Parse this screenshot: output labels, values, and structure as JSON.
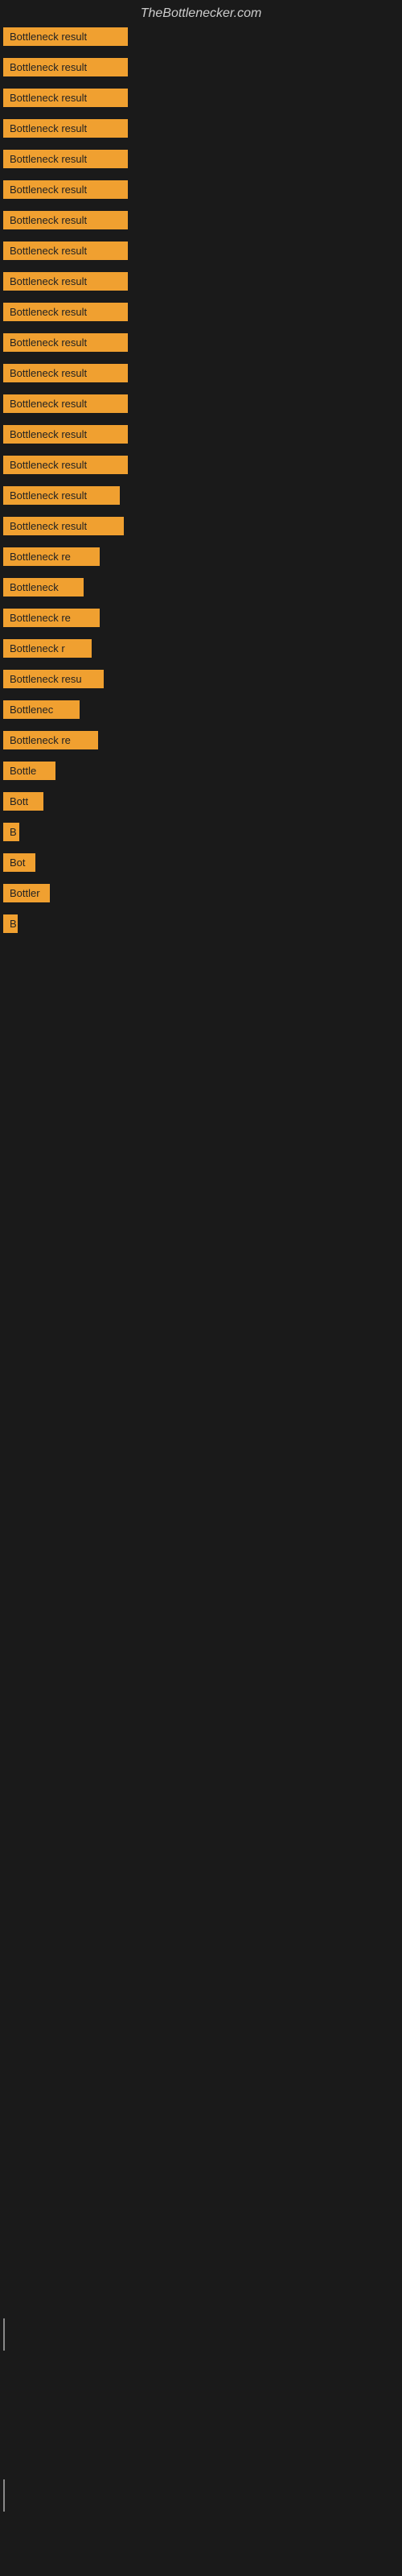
{
  "site": {
    "title": "TheBottlenecker.com"
  },
  "results": [
    {
      "label": "Bottleneck result",
      "width": 155
    },
    {
      "label": "Bottleneck result",
      "width": 155
    },
    {
      "label": "Bottleneck result",
      "width": 155
    },
    {
      "label": "Bottleneck result",
      "width": 155
    },
    {
      "label": "Bottleneck result",
      "width": 155
    },
    {
      "label": "Bottleneck result",
      "width": 155
    },
    {
      "label": "Bottleneck result",
      "width": 155
    },
    {
      "label": "Bottleneck result",
      "width": 155
    },
    {
      "label": "Bottleneck result",
      "width": 155
    },
    {
      "label": "Bottleneck result",
      "width": 155
    },
    {
      "label": "Bottleneck result",
      "width": 155
    },
    {
      "label": "Bottleneck result",
      "width": 155
    },
    {
      "label": "Bottleneck result",
      "width": 155
    },
    {
      "label": "Bottleneck result",
      "width": 155
    },
    {
      "label": "Bottleneck result",
      "width": 155
    },
    {
      "label": "Bottleneck result",
      "width": 145
    },
    {
      "label": "Bottleneck result",
      "width": 150
    },
    {
      "label": "Bottleneck re",
      "width": 120
    },
    {
      "label": "Bottleneck",
      "width": 100
    },
    {
      "label": "Bottleneck re",
      "width": 120
    },
    {
      "label": "Bottleneck r",
      "width": 110
    },
    {
      "label": "Bottleneck resu",
      "width": 125
    },
    {
      "label": "Bottlenec",
      "width": 95
    },
    {
      "label": "Bottleneck re",
      "width": 118
    },
    {
      "label": "Bottle",
      "width": 65
    },
    {
      "label": "Bott",
      "width": 50
    },
    {
      "label": "B",
      "width": 20
    },
    {
      "label": "Bot",
      "width": 40
    },
    {
      "label": "Bottler",
      "width": 58
    },
    {
      "label": "B",
      "width": 18
    }
  ]
}
